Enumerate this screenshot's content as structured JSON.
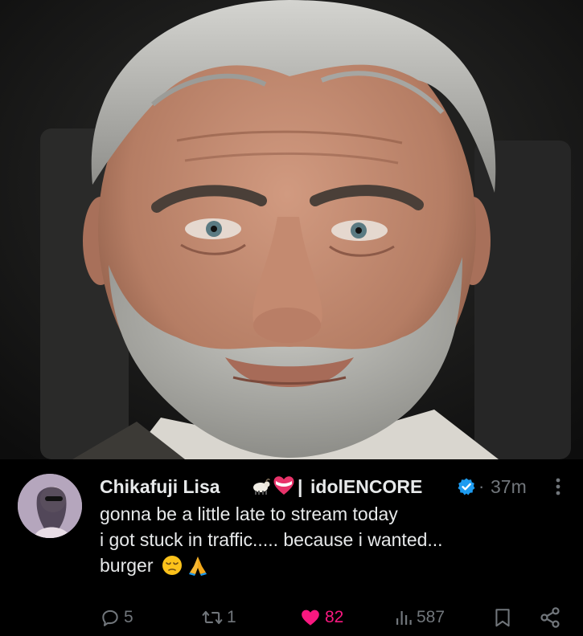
{
  "tweet": {
    "display_name": "Chikafuji Lisa",
    "name_emojis": [
      "goat-emoji",
      "heart-ribbon-emoji"
    ],
    "separator": "|",
    "secondary_name": "idolENCORE",
    "dot": "·",
    "time": "37m",
    "text_lines": [
      "gonna be a little late to stream today",
      "i got stuck in traffic..... because i wanted...",
      "burger"
    ],
    "text_emojis": [
      "pensive-face-emoji",
      "folded-hands-emoji"
    ]
  },
  "actions": {
    "replies": "5",
    "reposts": "1",
    "likes": "82",
    "views": "587"
  },
  "colors": {
    "background": "#000000",
    "text": "#e7e9ea",
    "secondary": "#71767b",
    "like": "#f91880",
    "verified": "#1d9bf0"
  }
}
